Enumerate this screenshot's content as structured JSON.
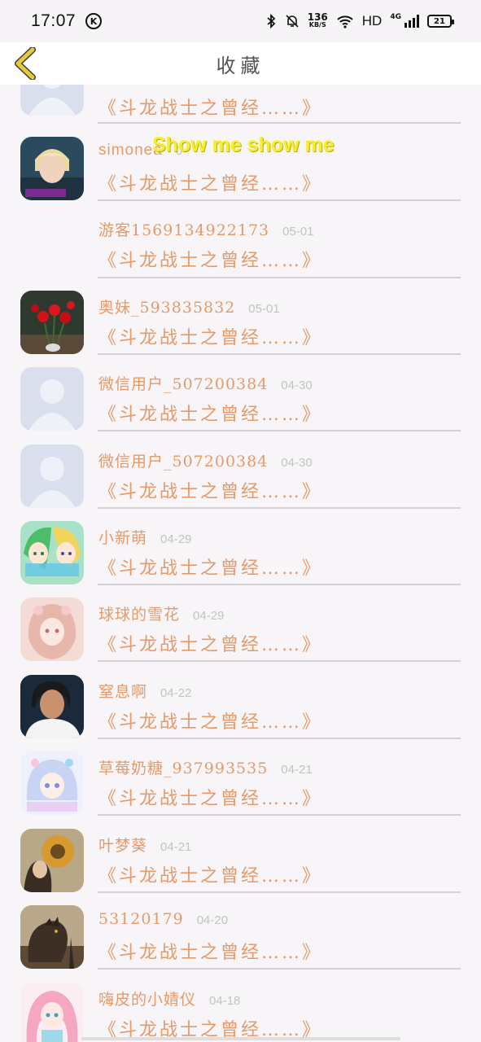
{
  "status_bar": {
    "time": "17:07",
    "k_badge": "K",
    "net_speed_value": "136",
    "net_speed_unit": "KB/S",
    "hd": "HD",
    "network_type": "4G",
    "battery": "21"
  },
  "header": {
    "title": "收藏"
  },
  "overlay_caption": "Show me show me",
  "book_title": "《斗龙战士之曾经……》",
  "items": [
    {
      "user": "",
      "date": "",
      "avatar": "default"
    },
    {
      "user": "simonea",
      "date": "0",
      "avatar": "photo-blond"
    },
    {
      "user": "游客15691349221​73",
      "date": "05-01",
      "avatar": "none"
    },
    {
      "user": "奥妹_593835832",
      "date": "05-01",
      "avatar": "photo-roses"
    },
    {
      "user": "微信用户_507200384",
      "date": "04-30",
      "avatar": "default"
    },
    {
      "user": "微信用户_507200384",
      "date": "04-30",
      "avatar": "default"
    },
    {
      "user": "小新萌",
      "date": "04-29",
      "avatar": "anime-green"
    },
    {
      "user": "球球的雪花",
      "date": "04-29",
      "avatar": "anime-pink"
    },
    {
      "user": "窒息啊",
      "date": "04-22",
      "avatar": "photo-person"
    },
    {
      "user": "草莓奶糖_937993535",
      "date": "04-21",
      "avatar": "anime-pastel"
    },
    {
      "user": "叶梦葵",
      "date": "04-21",
      "avatar": "art-sunflower"
    },
    {
      "user": "53120179",
      "date": "04-20",
      "avatar": "art-godzilla"
    },
    {
      "user": "嗨皮的小婧仪",
      "date": "04-18",
      "avatar": "anime-pinkhair"
    }
  ],
  "colors": {
    "accent": "#e49a6a",
    "date": "#c3c3c3",
    "divider": "#d3d1d3",
    "back_arrow": "#e2c23a",
    "caption": "#f4ee2f"
  }
}
